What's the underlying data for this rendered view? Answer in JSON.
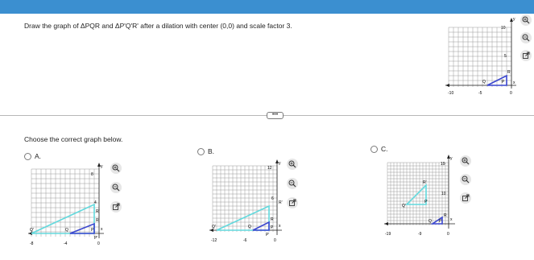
{
  "question": {
    "text": "Draw the graph of ΔPQR and ΔP'Q'R' after a dilation with center (0,0) and scale factor 3."
  },
  "more_button": {
    "label": "•••"
  },
  "prompt": {
    "text": "Choose the correct graph below."
  },
  "options": [
    {
      "letter": "A."
    },
    {
      "letter": "B."
    },
    {
      "letter": "C."
    }
  ],
  "colors": {
    "topbar": "#3b8fd0",
    "original_triangle": "#3a46cf",
    "image_triangle": "#62d9dd",
    "grid": "#9a9a9a"
  },
  "icons": [
    "zoom-in-icon",
    "zoom-out-icon",
    "external-link-icon"
  ],
  "graphs": {
    "question": {
      "y_label": "y",
      "x_label": "x",
      "tick_x": [
        "-10",
        "-5",
        "0"
      ],
      "tick_y": [
        "10",
        "5"
      ],
      "points": [
        "Q",
        "P",
        "R"
      ]
    },
    "a": {
      "y_label": "y",
      "x_label": "x",
      "tick_x": [
        "-8",
        "-4",
        "0"
      ],
      "tick_y": [
        "8",
        "4"
      ],
      "points": [
        "Q",
        "P",
        "R",
        "Q'",
        "P'",
        "R'"
      ]
    },
    "b": {
      "y_label": "y",
      "x_label": "x",
      "tick_x": [
        "-12",
        "-6",
        "0"
      ],
      "tick_y": [
        "12",
        "6"
      ],
      "points": [
        "Q",
        "P",
        "R",
        "Q'",
        "P'",
        "R'"
      ]
    },
    "c": {
      "y_label": "y",
      "x_label": "x",
      "tick_x": [
        "-19",
        "-9",
        "0"
      ],
      "tick_y": [
        "19",
        "10"
      ],
      "points": [
        "Q",
        "P",
        "R",
        "Q'",
        "P'",
        "R'"
      ]
    }
  }
}
